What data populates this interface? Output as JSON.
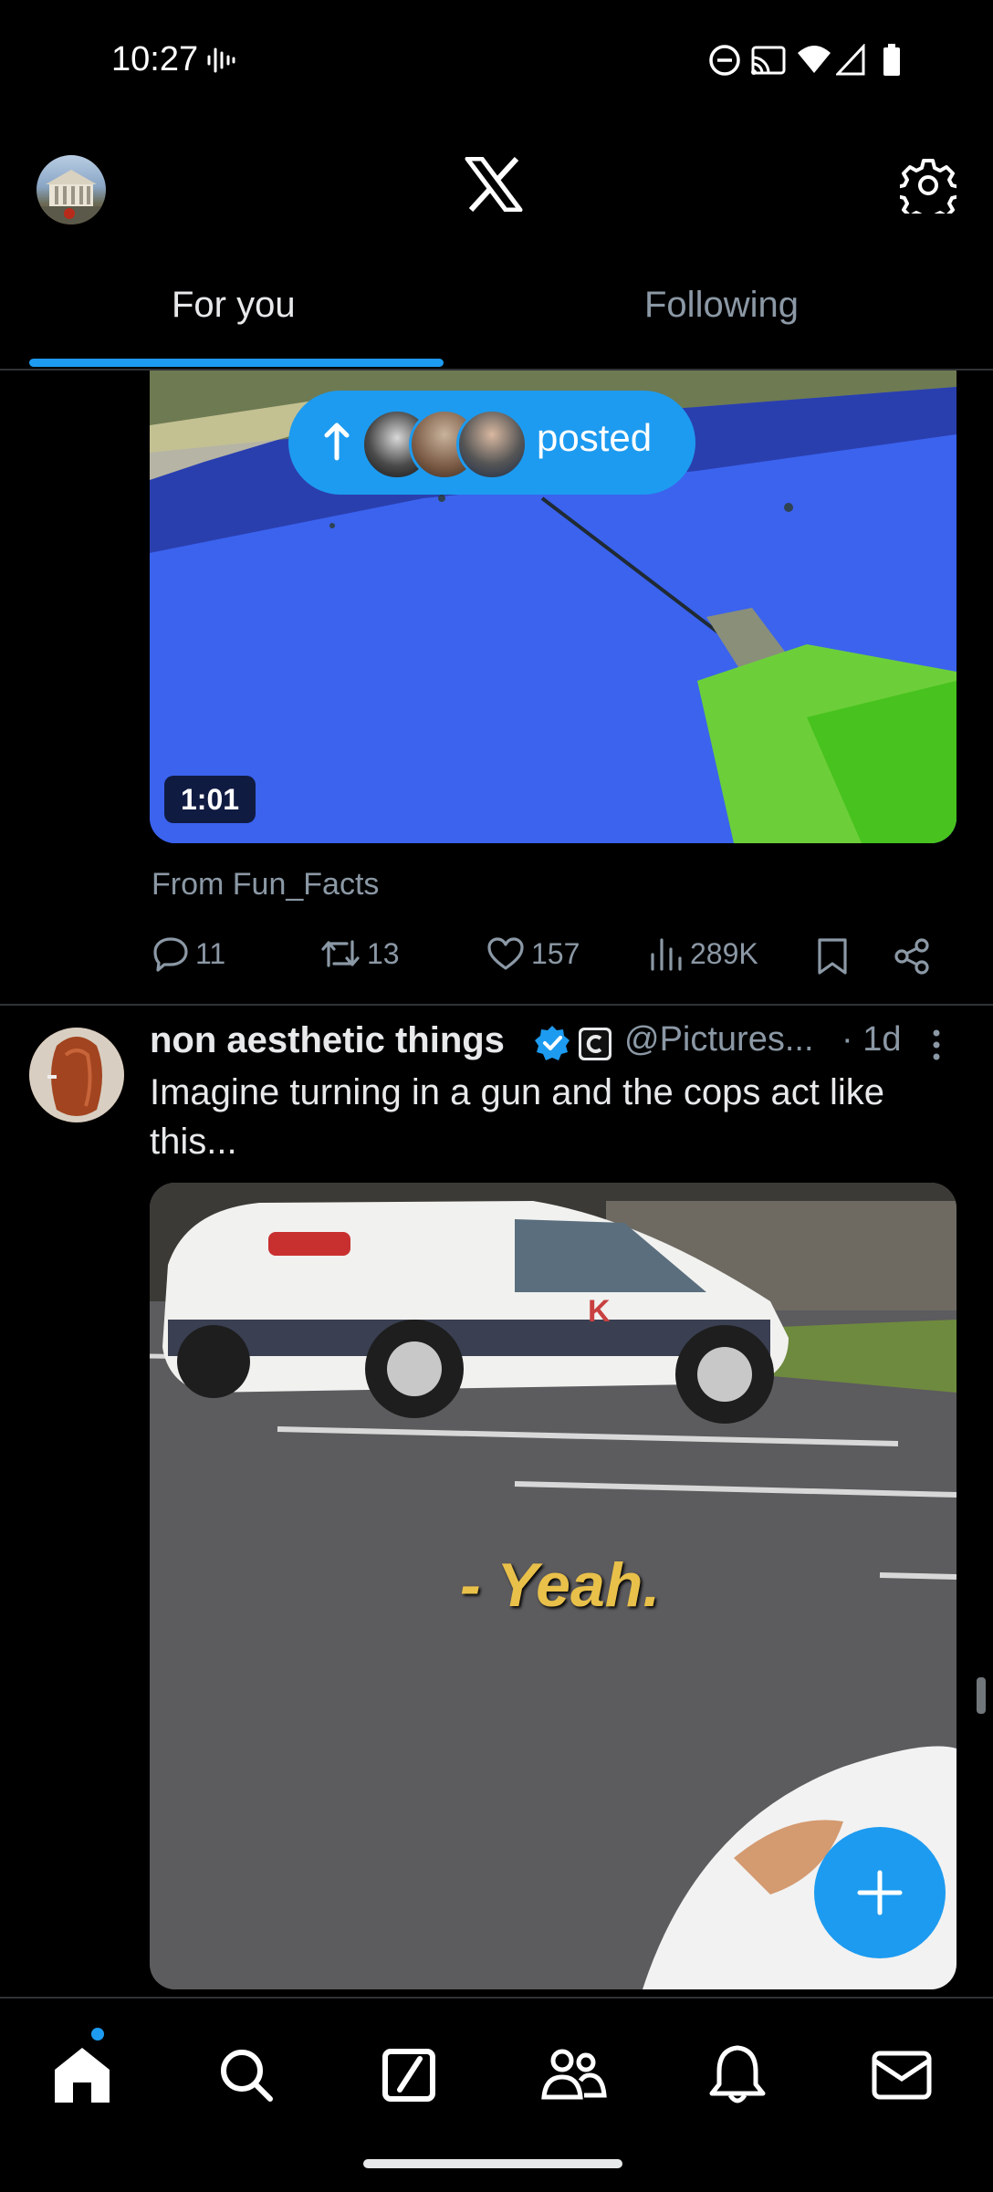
{
  "status_bar": {
    "time": "10:27",
    "icons": [
      "voice-wave-icon",
      "do-not-disturb-icon",
      "cast-icon",
      "wifi-icon",
      "signal-icon",
      "battery-icon"
    ]
  },
  "header": {
    "logo": "X"
  },
  "tabs": [
    {
      "label": "For you",
      "active": true
    },
    {
      "label": "Following",
      "active": false
    }
  ],
  "posted_pill": {
    "label": "posted"
  },
  "post1": {
    "duration": "1:01",
    "from": "From Fun_Facts",
    "actions": {
      "replies": "11",
      "reposts": "13",
      "likes": "157",
      "views": "289K"
    }
  },
  "post2": {
    "author": "non aesthetic things",
    "handle": "@Pictures...",
    "age": "· 1d",
    "text": "Imagine turning in a gun and the cops act like this...",
    "caption": "- Yeah."
  },
  "colors": {
    "accent": "#1d9bf0",
    "background": "#000000",
    "muted_text": "#8b98a5",
    "divider": "#2f3336"
  },
  "nav": [
    {
      "name": "home-icon",
      "has_badge": true
    },
    {
      "name": "search-icon"
    },
    {
      "name": "grok-icon"
    },
    {
      "name": "communities-icon"
    },
    {
      "name": "notifications-icon"
    },
    {
      "name": "messages-icon"
    }
  ]
}
